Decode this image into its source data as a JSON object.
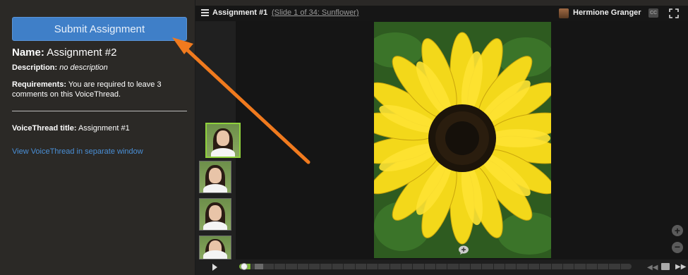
{
  "assignment": {
    "submit_label": "Submit Assignment",
    "name_label": "Name:",
    "name_value": "Assignment #2",
    "description_label": "Description:",
    "description_value": "no description",
    "requirements_label": "Requirements:",
    "requirements_value": "You are required to leave 3 comments on this VoiceThread.",
    "vt_title_label": "VoiceThread title:",
    "vt_title_value": "Assignment #1",
    "vt_link": "View VoiceThread in separate window"
  },
  "viewer": {
    "title": "Assignment #1",
    "slide_info": "(Slide 1 of 34: Sunflower)",
    "user_name": "Hermione Granger",
    "cc_label": "CC",
    "zoom_in": "+",
    "zoom_out": "−"
  },
  "icons": {
    "menu": "menu-icon",
    "fullscreen": "fullscreen-icon",
    "play": "play-icon",
    "comment": "comment-bubble-icon",
    "zoom_in": "zoom-in-icon",
    "zoom_out": "zoom-out-icon"
  },
  "colors": {
    "submit_button": "#3f7fc8",
    "link": "#4a8fd6",
    "progress": "#7fb93a",
    "annotation_arrow": "#f07a1e"
  }
}
